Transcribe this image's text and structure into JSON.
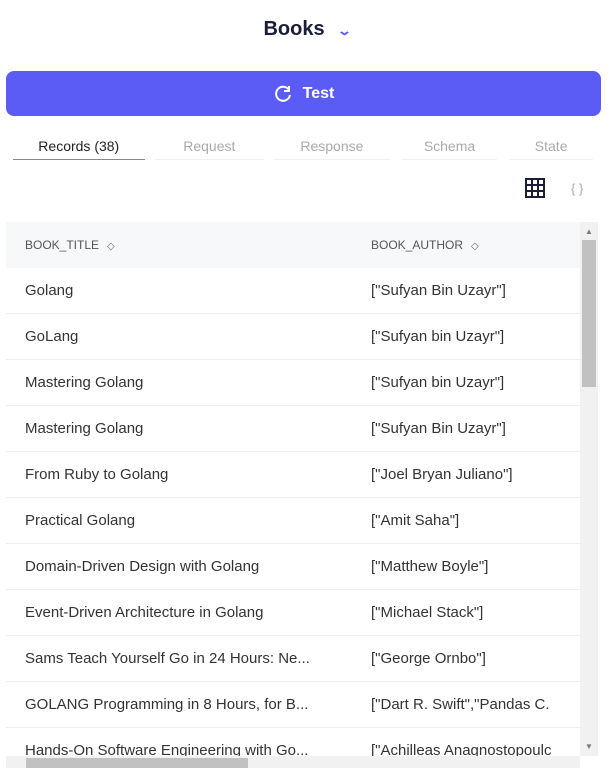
{
  "header": {
    "title": "Books"
  },
  "test_button": {
    "label": "Test"
  },
  "tabs": [
    {
      "label": "Records (38)"
    },
    {
      "label": "Request"
    },
    {
      "label": "Response"
    },
    {
      "label": "Schema"
    },
    {
      "label": "State"
    }
  ],
  "view_toggle": {
    "table": "grid-icon",
    "json": "{ }"
  },
  "table": {
    "columns": [
      "BOOK_TITLE",
      "BOOK_AUTHOR"
    ],
    "rows": [
      [
        "Golang",
        "[\"Sufyan Bin Uzayr\"]"
      ],
      [
        "GoLang",
        "[\"Sufyan bin Uzayr\"]"
      ],
      [
        "Mastering Golang",
        "[\"Sufyan bin Uzayr\"]"
      ],
      [
        "Mastering Golang",
        "[\"Sufyan Bin Uzayr\"]"
      ],
      [
        "From Ruby to Golang",
        "[\"Joel Bryan Juliano\"]"
      ],
      [
        "Practical Golang",
        "[\"Amit Saha\"]"
      ],
      [
        "Domain-Driven Design with Golang",
        "[\"Matthew Boyle\"]"
      ],
      [
        "Event-Driven Architecture in Golang",
        "[\"Michael Stack\"]"
      ],
      [
        "Sams Teach Yourself Go in 24 Hours: Ne...",
        "[\"George Ornbo\"]"
      ],
      [
        "GOLANG Programming in 8 Hours, for B...",
        "[\"Dart R. Swift\",\"Pandas C."
      ],
      [
        "Hands-On Software Engineering with Go...",
        "[\"Achilleas Anagnostopoulc"
      ]
    ]
  },
  "colors": {
    "accent": "#5b5cf6"
  }
}
